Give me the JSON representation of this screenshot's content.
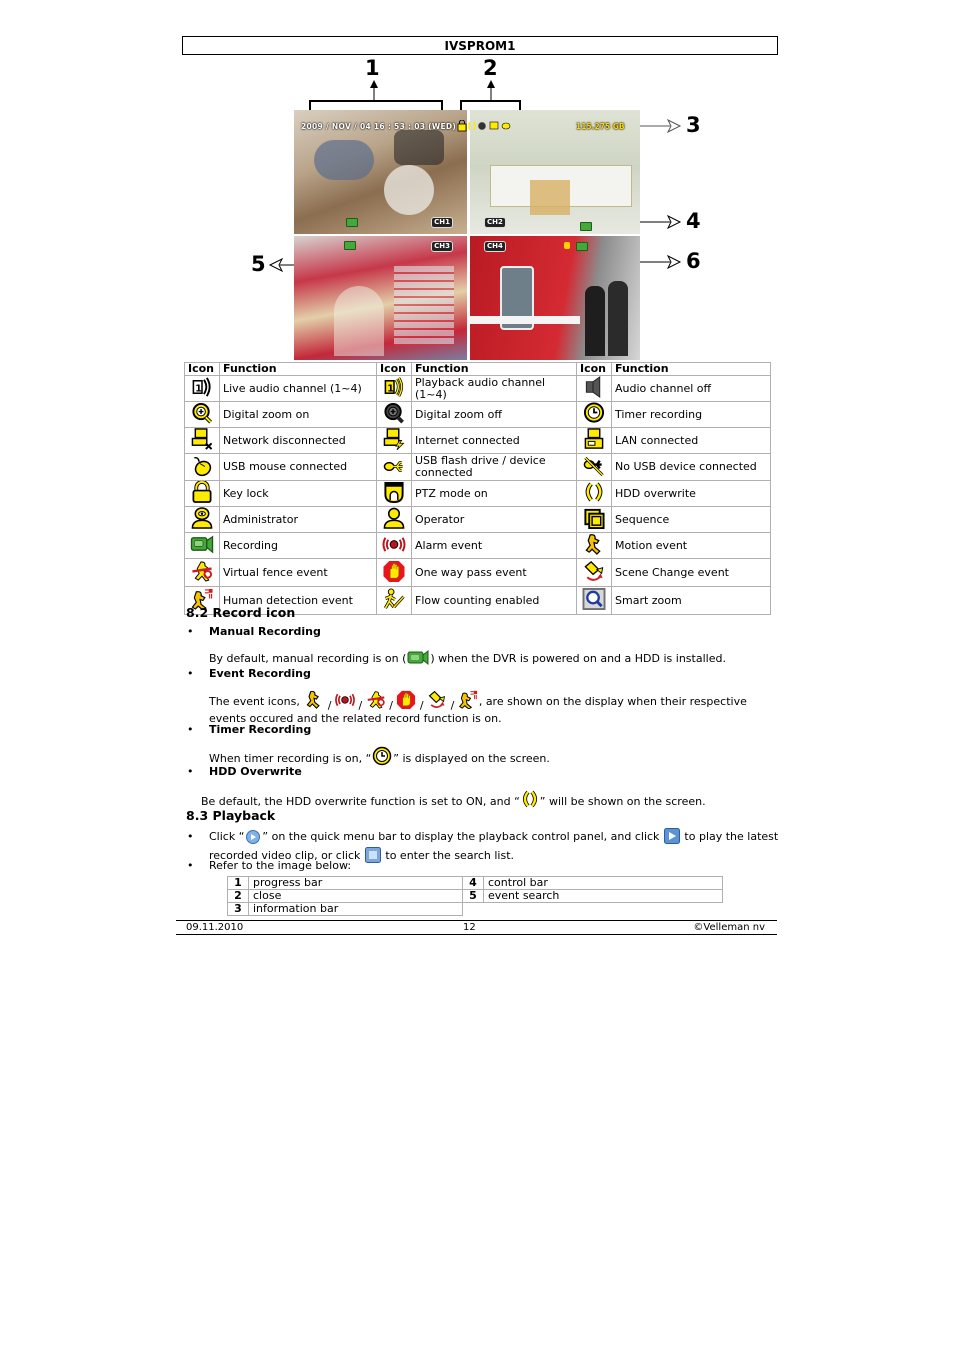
{
  "header": {
    "title": "IVSPROM1"
  },
  "figure": {
    "callouts": [
      "1",
      "2",
      "3",
      "4",
      "5",
      "6"
    ],
    "osd": {
      "datetime": "2009 / NOV / 04  16 : 53 : 03  (WED)",
      "hdd_capacity": "115.275 GB"
    },
    "channels": [
      {
        "label": "CH1",
        "scene": "office meeting"
      },
      {
        "label": "CH2",
        "scene": "hospital ward"
      },
      {
        "label": "CH3",
        "scene": "store shelves"
      },
      {
        "label": "CH4",
        "scene": "subway train"
      }
    ]
  },
  "icon_table": {
    "headers": [
      "Icon",
      "Function",
      "Icon",
      "Function",
      "Icon",
      "Function"
    ],
    "rows": [
      [
        {
          "icon": "live-audio-icon",
          "label": "Live audio channel (1~4)"
        },
        {
          "icon": "playback-audio-icon",
          "label": "Playback audio channel (1~4)"
        },
        {
          "icon": "audio-off-icon",
          "label": "Audio channel off"
        }
      ],
      [
        {
          "icon": "zoom-on-icon",
          "label": "Digital zoom on"
        },
        {
          "icon": "zoom-off-icon",
          "label": "Digital zoom off"
        },
        {
          "icon": "timer-icon",
          "label": "Timer recording"
        }
      ],
      [
        {
          "icon": "network-disconnected-icon",
          "label": "Network disconnected"
        },
        {
          "icon": "internet-connected-icon",
          "label": "Internet connected"
        },
        {
          "icon": "lan-connected-icon",
          "label": "LAN connected"
        }
      ],
      [
        {
          "icon": "usb-mouse-icon",
          "label": "USB mouse connected"
        },
        {
          "icon": "usb-drive-icon",
          "label": "USB flash drive / device connected"
        },
        {
          "icon": "no-usb-icon",
          "label": "No USB device connected"
        }
      ],
      [
        {
          "icon": "key-lock-icon",
          "label": "Key lock"
        },
        {
          "icon": "ptz-icon",
          "label": "PTZ mode on"
        },
        {
          "icon": "hdd-overwrite-icon",
          "label": "HDD overwrite"
        }
      ],
      [
        {
          "icon": "administrator-icon",
          "label": "Administrator"
        },
        {
          "icon": "operator-icon",
          "label": "Operator"
        },
        {
          "icon": "sequence-icon",
          "label": "Sequence"
        }
      ],
      [
        {
          "icon": "recording-icon",
          "label": "Recording"
        },
        {
          "icon": "alarm-icon",
          "label": "Alarm event"
        },
        {
          "icon": "motion-icon",
          "label": "Motion event"
        }
      ],
      [
        {
          "icon": "virtual-fence-icon",
          "label": "Virtual fence event"
        },
        {
          "icon": "one-way-pass-icon",
          "label": "One way pass event"
        },
        {
          "icon": "scene-change-icon",
          "label": "Scene Change event"
        }
      ],
      [
        {
          "icon": "human-detection-icon",
          "label": "Human detection event"
        },
        {
          "icon": "flow-counting-icon",
          "label": "Flow counting enabled"
        },
        {
          "icon": "smart-zoom-icon",
          "label": "Smart zoom"
        }
      ]
    ]
  },
  "section_8_2": {
    "title": "8.2 Record icon",
    "manual": {
      "label": "Manual Recording",
      "text_before": "By default, manual recording is on (",
      "text_after": ") when the DVR is powered on and a HDD is installed."
    },
    "event": {
      "label": "Event Recording",
      "text_before": "The event icons, ",
      "separator": " / ",
      "text_after": ", are shown on the display when their respective",
      "text_line2": "events occured and the related record function is on."
    },
    "timer": {
      "label": "Timer Recording",
      "text_before": "When timer recording is on, “",
      "text_after": "” is displayed on the screen."
    },
    "hdd": {
      "label": "HDD Overwrite",
      "text_before": "Be default, the HDD overwrite function is set to ON, and “",
      "text_after": "” will be shown on the screen."
    }
  },
  "section_8_3": {
    "title": "8.3 Playback",
    "bullet1_a": "Click “",
    "bullet1_b": "” on the quick menu bar to display the playback control panel, and click ",
    "bullet1_c": " to play the latest",
    "bullet1_line2_a": "recorded video clip, or click ",
    "bullet1_line2_b": " to enter the search list.",
    "bullet2": "Refer to the image below:",
    "legend": [
      {
        "num": "1",
        "label": "progress bar"
      },
      {
        "num": "2",
        "label": "close"
      },
      {
        "num": "3",
        "label": "information bar"
      },
      {
        "num": "4",
        "label": "control bar"
      },
      {
        "num": "5",
        "label": "event search"
      }
    ]
  },
  "footer": {
    "date": "09.11.2010",
    "page": "12",
    "copyright": "©Velleman nv"
  },
  "colors": {
    "icon_yellow": "#ffea00",
    "record_green": "#46a83a",
    "alarm_red": "#c0141c",
    "border_gray": "#b0b0b0"
  }
}
